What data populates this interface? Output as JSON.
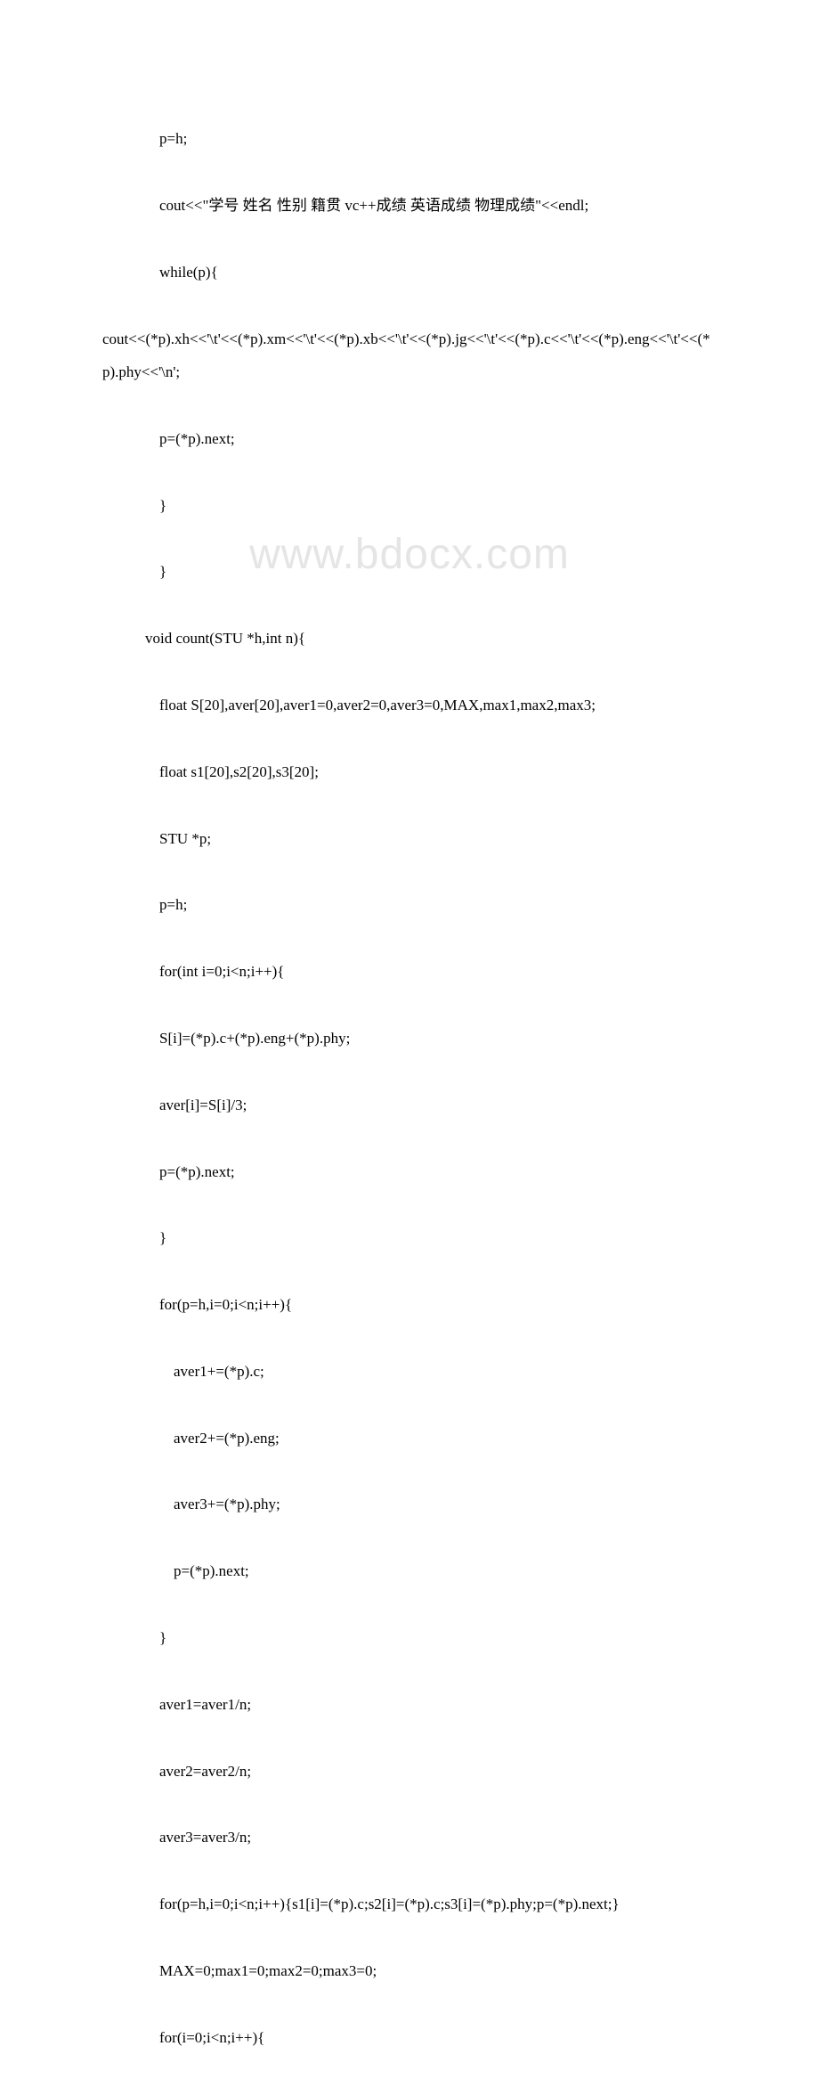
{
  "watermark": "www.bdocx.com",
  "code": {
    "line1": "p=h;",
    "line2": "cout<<\"学号 姓名 性别 籍贯 vc++成绩 英语成绩 物理成绩\"<<endl;",
    "line3": "while(p){",
    "line4": "cout<<(*p).xh<<'\\t'<<(*p).xm<<'\\t'<<(*p).xb<<'\\t'<<(*p).jg<<'\\t'<<(*p).c<<'\\t'<<(*p).eng<<'\\t'<<(*p).phy<<'\\n';",
    "line5": "p=(*p).next;",
    "line6": "}",
    "line7": "}",
    "line8": "void count(STU *h,int n){",
    "line9": "float S[20],aver[20],aver1=0,aver2=0,aver3=0,MAX,max1,max2,max3;",
    "line10": "float s1[20],s2[20],s3[20];",
    "line11": "STU *p;",
    "line12": "p=h;",
    "line13": "for(int i=0;i<n;i++){",
    "line14": "S[i]=(*p).c+(*p).eng+(*p).phy;",
    "line15": "aver[i]=S[i]/3;",
    "line16": "p=(*p).next;",
    "line17": "}",
    "line18": "for(p=h,i=0;i<n;i++){",
    "line19": "aver1+=(*p).c;",
    "line20": "aver2+=(*p).eng;",
    "line21": "aver3+=(*p).phy;",
    "line22": "p=(*p).next;",
    "line23": "}",
    "line24": "aver1=aver1/n;",
    "line25": "aver2=aver2/n;",
    "line26": "aver3=aver3/n;",
    "line27": "for(p=h,i=0;i<n;i++){s1[i]=(*p).c;s2[i]=(*p).c;s3[i]=(*p).phy;p=(*p).next;}",
    "line28": "MAX=0;max1=0;max2=0;max3=0;",
    "line29": "for(i=0;i<n;i++){"
  }
}
